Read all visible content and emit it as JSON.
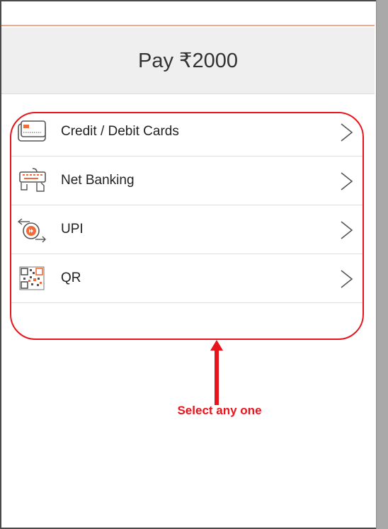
{
  "header": {
    "title": "Pay ₹2000"
  },
  "options": [
    {
      "label": "Credit / Debit Cards",
      "icon": "card-icon"
    },
    {
      "label": "Net Banking",
      "icon": "keyboard-hand-icon"
    },
    {
      "label": "UPI",
      "icon": "upi-transfer-icon"
    },
    {
      "label": "QR",
      "icon": "qr-code-icon"
    }
  ],
  "annotation": {
    "note": "Select any one"
  },
  "colors": {
    "accent": "#e8141c",
    "icon_orange": "#f26b3a",
    "header_bg": "#efefef",
    "top_line": "#f3a78c"
  }
}
